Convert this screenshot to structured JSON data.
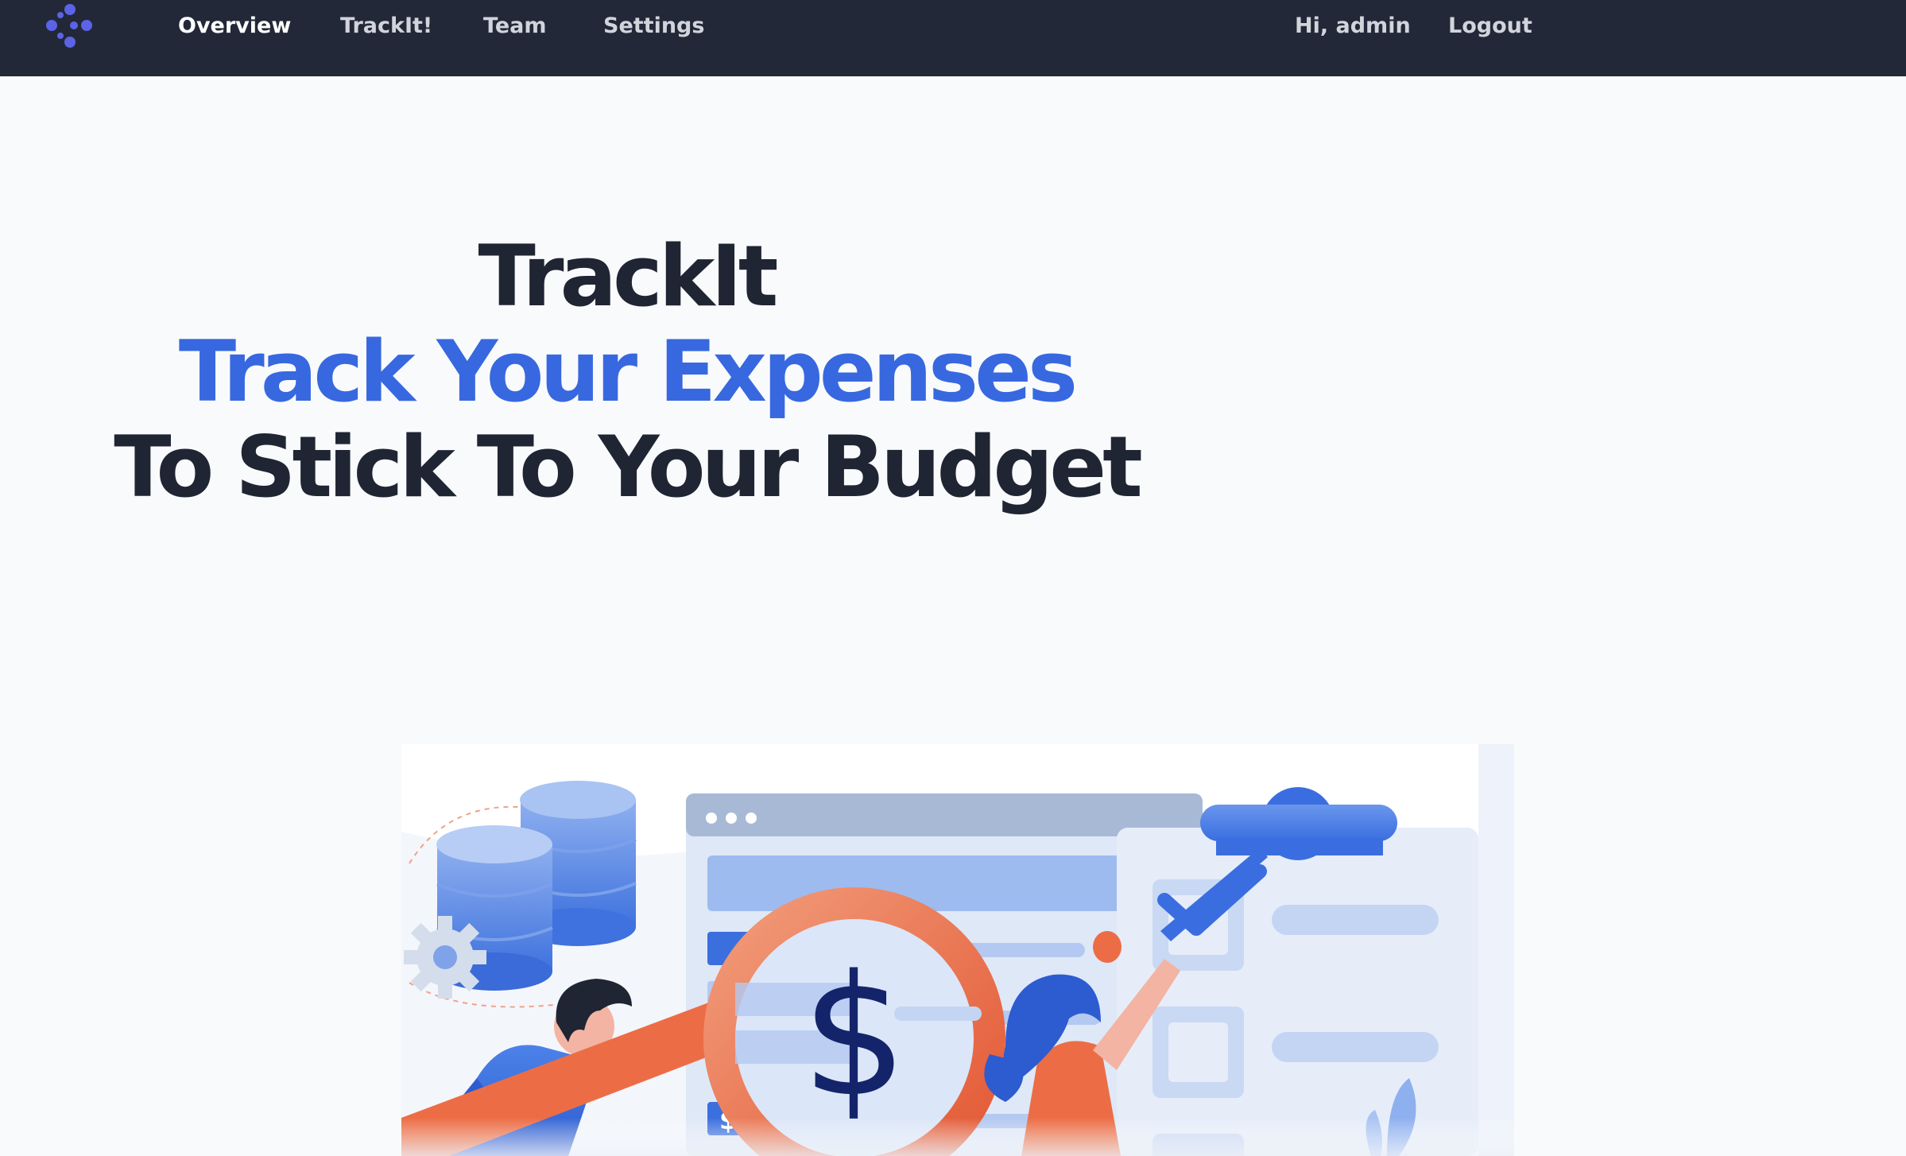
{
  "nav": {
    "logo_icon": "dots-logo-icon",
    "links": [
      {
        "label": "Overview",
        "active": true
      },
      {
        "label": "TrackIt!",
        "active": false
      },
      {
        "label": "Team",
        "active": false
      },
      {
        "label": "Settings",
        "active": false
      }
    ],
    "greeting": "Hi, admin",
    "logout_label": "Logout"
  },
  "hero": {
    "line1": "TrackIt",
    "line2": "Track Your Expenses",
    "line3": "To Stick To Your Budget"
  },
  "illustration": {
    "icon": "expense-tracking-illustration",
    "dollar_symbol": "$",
    "small_dollar_symbol": "$"
  },
  "colors": {
    "nav_bg": "#222838",
    "page_bg": "#f9fafb",
    "heading": "#1f2533",
    "accent": "#3868e0",
    "logo": "#5b63e6",
    "magnifier": "#e8643c"
  }
}
